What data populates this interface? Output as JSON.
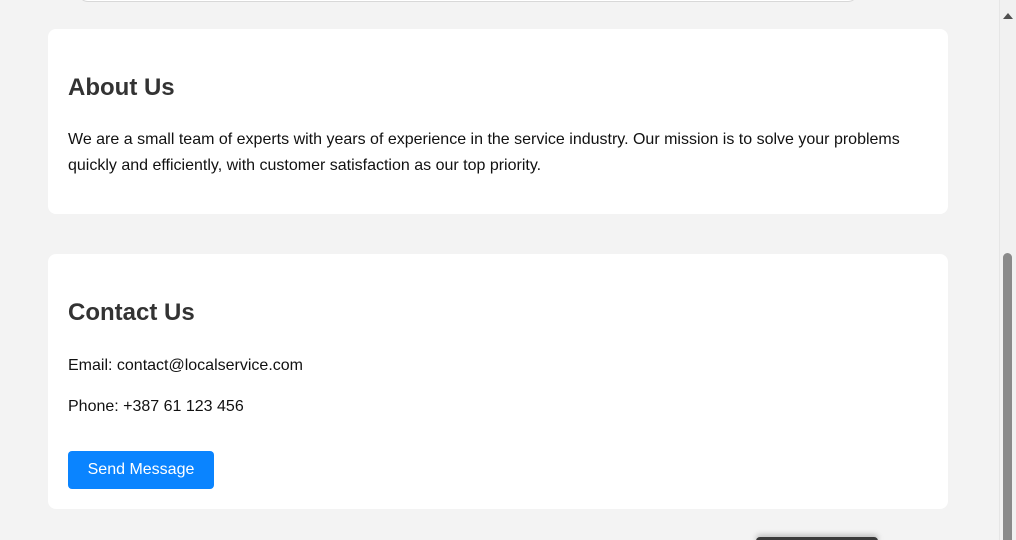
{
  "about": {
    "title": "About Us",
    "text": "We are a small team of experts with years of experience in the service industry. Our mission is to solve your problems quickly and efficiently, with customer satisfaction as our top priority."
  },
  "contact": {
    "title": "Contact Us",
    "email": "Email: contact@localservice.com",
    "phone": "Phone: +387 61 123 456",
    "send_label": "Send Message"
  },
  "colors": {
    "accent": "#0a84ff",
    "page_bg": "#f3f3f3",
    "card_bg": "#ffffff",
    "heading": "#333333"
  },
  "icons": {
    "scroll_up": "scroll-up-arrow-icon"
  }
}
